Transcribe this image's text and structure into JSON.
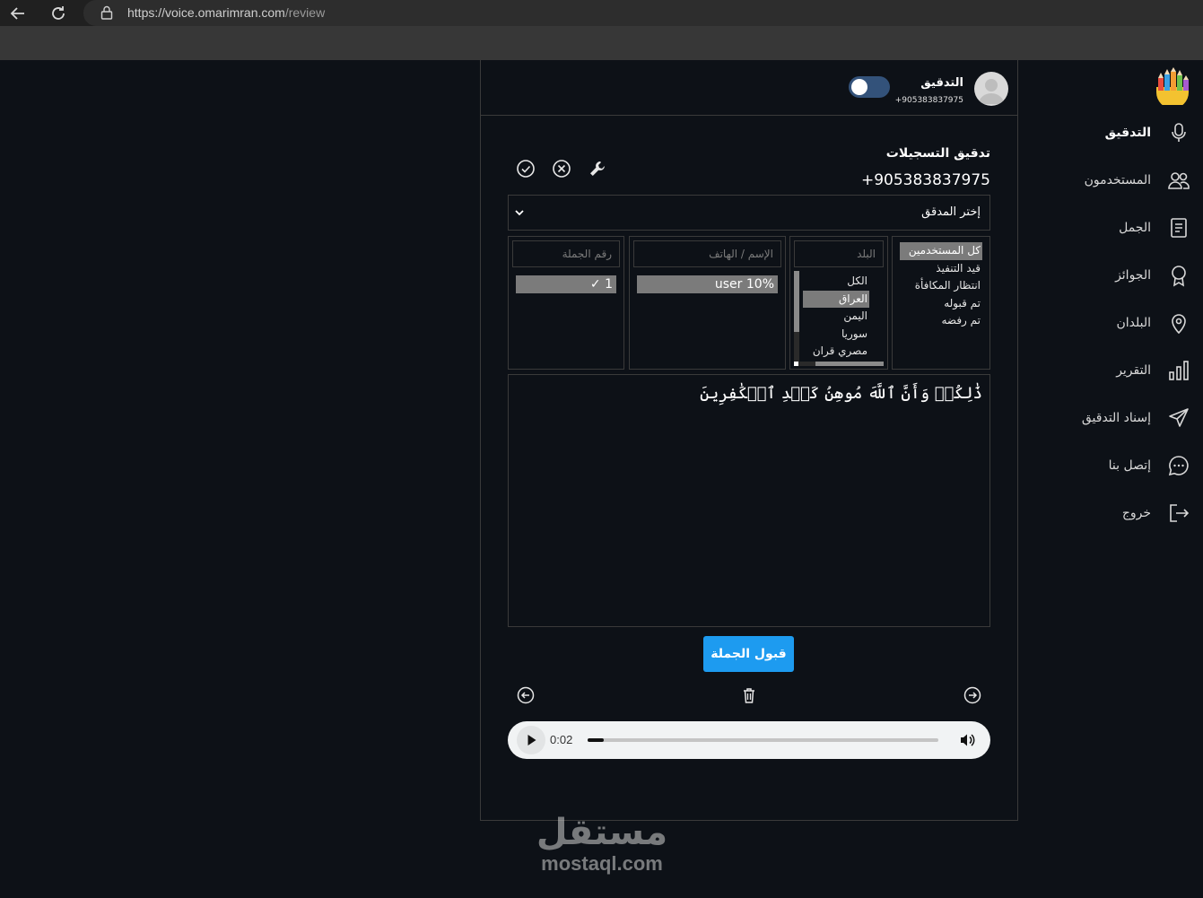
{
  "browser": {
    "url_host": "https://voice.omarimran.com",
    "url_path": "/review"
  },
  "sidebar": {
    "items": [
      {
        "label": "التدقيق",
        "icon": "mic-icon"
      },
      {
        "label": "المستخدمون",
        "icon": "users-icon"
      },
      {
        "label": "الجمل",
        "icon": "document-icon"
      },
      {
        "label": "الجوائز",
        "icon": "award-icon"
      },
      {
        "label": "البلدان",
        "icon": "map-pin-icon"
      },
      {
        "label": "التقرير",
        "icon": "bar-chart-icon"
      },
      {
        "label": "إسناد التدقيق",
        "icon": "send-icon"
      },
      {
        "label": "إتصل بنا",
        "icon": "chat-icon"
      },
      {
        "label": "خروج",
        "icon": "logout-icon"
      }
    ],
    "active_index": 0
  },
  "header": {
    "name": "التدقيق",
    "phone": "+905383837975",
    "toggle_on": false
  },
  "main": {
    "title": "تدقيق التسجيلات",
    "phone": "+905383837975",
    "reviewer_select": "إختر المدقق",
    "status_options": [
      "كل المستخدمين",
      "قيد التنفيذ",
      "انتظار المكافأة",
      "تم قبوله",
      "تم رفضه"
    ],
    "status_selected": 0,
    "country_placeholder": "البلد",
    "country_options": [
      "الكل",
      "العراق",
      "اليمن",
      "سوريا",
      "مصري قران"
    ],
    "country_selected": 1,
    "name_placeholder": "الإسم / الهاتف",
    "name_option": "user 10%",
    "sentence_placeholder": "رقم الجملة",
    "sentence_option": "1 ✓",
    "verse_text": "ذَٰلِكُمۡ وَأَنَّ ٱللَّهَ مُوهِنُ كَيۡدِ ٱلۡكَٰفِرِينَ",
    "accept_label": "قبول الجملة"
  },
  "audio": {
    "current_time": "0:02",
    "progress": 0.045
  },
  "watermark": {
    "arabic": "مستقل",
    "latin": "mostaql.com"
  },
  "colors": {
    "background": "#0d1117",
    "accent": "#1d9bf0",
    "selected": "#7b7b7b"
  }
}
